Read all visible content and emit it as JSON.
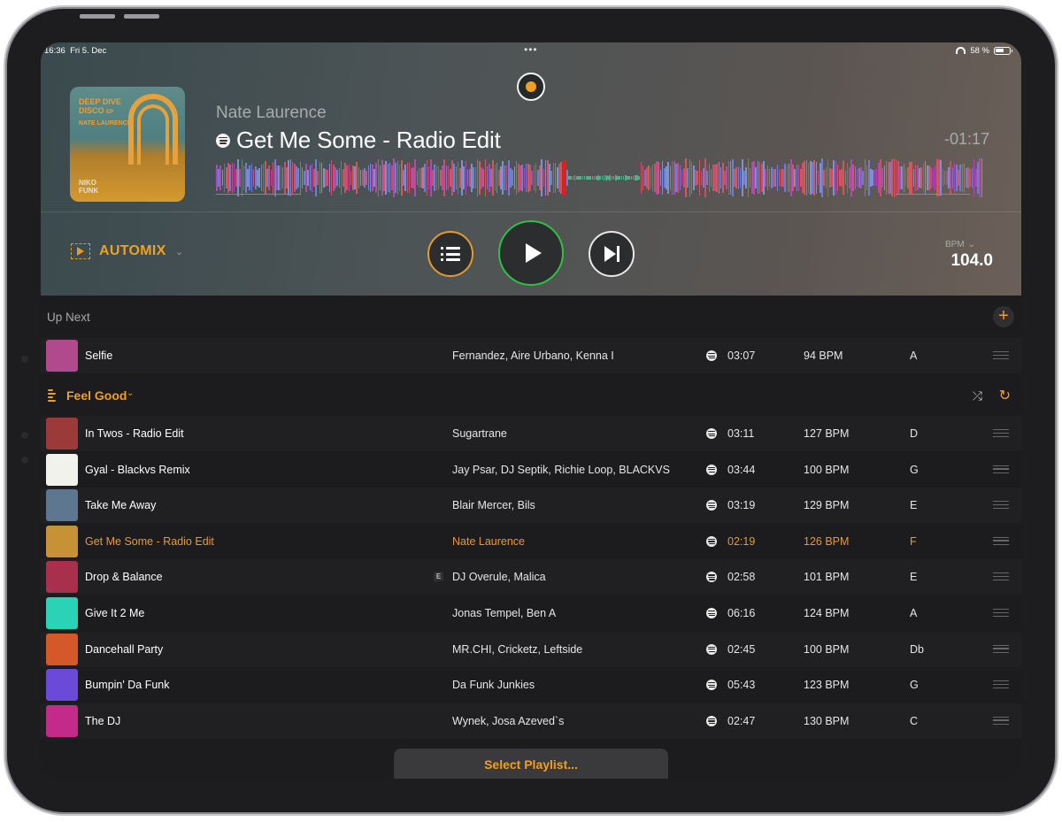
{
  "status_bar": {
    "time": "16:36",
    "date": "Fri 5. Dec",
    "battery": "58 %"
  },
  "now_playing": {
    "artist": "Nate Laurence",
    "title": "Get Me Some - Radio Edit",
    "remaining": "-01:17",
    "cover": {
      "line1": "DEEP DIVE",
      "line2": "DISCO",
      "ep": "EP",
      "artist": "NATE LAURENCE",
      "label": "NIKO FUNK"
    }
  },
  "controls": {
    "automix_label": "AUTOMIX",
    "bpm_label": "BPM",
    "bpm_value": "104.0"
  },
  "up_next": {
    "title": "Up Next",
    "track": {
      "title": "Selfie",
      "artist": "Fernandez, Aire Urbano, Kenna I",
      "duration": "03:07",
      "bpm": "94 BPM",
      "key": "A",
      "thumb_color": "#b04a8c"
    }
  },
  "playlist": {
    "name": "Feel Good",
    "tracks": [
      {
        "title": "In Twos - Radio Edit",
        "artist": "Sugartrane",
        "duration": "03:11",
        "bpm": "127 BPM",
        "key": "D",
        "thumb_color": "#9c3a3a"
      },
      {
        "title": "Gyal - Blackvs Remix",
        "artist": "Jay Psar, DJ Septik, Richie Loop, BLACKVS",
        "duration": "03:44",
        "bpm": "100 BPM",
        "key": "G",
        "thumb_color": "#f2f2ec"
      },
      {
        "title": "Take Me Away",
        "artist": "Blair Mercer, Bils",
        "duration": "03:19",
        "bpm": "129 BPM",
        "key": "E",
        "thumb_color": "#5d7790"
      },
      {
        "title": "Get Me Some - Radio Edit",
        "artist": "Nate Laurence",
        "duration": "02:19",
        "bpm": "126 BPM",
        "key": "F",
        "thumb_color": "#c79236",
        "playing": true
      },
      {
        "title": "Drop & Balance",
        "artist": "DJ Overule, Malica",
        "duration": "02:58",
        "bpm": "101 BPM",
        "key": "E",
        "thumb_color": "#a8304c",
        "explicit": "E"
      },
      {
        "title": "Give It 2 Me",
        "artist": "Jonas Tempel, Ben A",
        "duration": "06:16",
        "bpm": "124 BPM",
        "key": "A",
        "thumb_color": "#2ad3b6"
      },
      {
        "title": "Dancehall Party",
        "artist": "MR.CHI, Cricketz, Leftside",
        "duration": "02:45",
        "bpm": "100 BPM",
        "key": "Db",
        "thumb_color": "#d4582a"
      },
      {
        "title": "Bumpin' Da Funk",
        "artist": "Da Funk Junkies",
        "duration": "05:43",
        "bpm": "123 BPM",
        "key": "G",
        "thumb_color": "#6a4ad6"
      },
      {
        "title": "The DJ",
        "artist": "Wynek, Josa Azeved`s",
        "duration": "02:47",
        "bpm": "130 BPM",
        "key": "C",
        "thumb_color": "#c42a8a"
      }
    ]
  },
  "select_playlist_label": "Select Playlist...",
  "colors": {
    "accent": "#f0a020",
    "play_ring": "#2ec244",
    "playhead": "#e0201f"
  }
}
